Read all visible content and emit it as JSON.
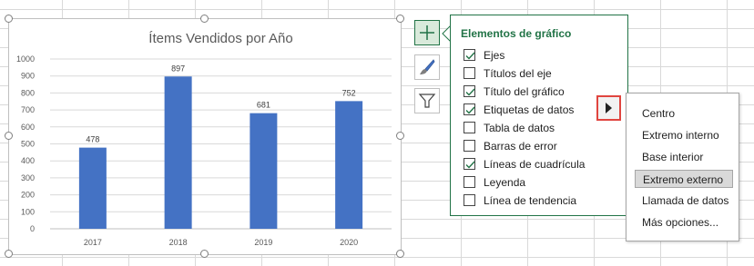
{
  "chart_data": {
    "type": "bar",
    "title": "Ítems Vendidos por Año",
    "categories": [
      "2017",
      "2018",
      "2019",
      "2020"
    ],
    "values": [
      478,
      897,
      681,
      752
    ],
    "ylim": [
      0,
      1000
    ],
    "yticks": [
      "0",
      "100",
      "200",
      "300",
      "400",
      "500",
      "600",
      "700",
      "800",
      "900",
      "1000"
    ],
    "bar_color": "#4472c4",
    "grid": true,
    "data_labels": [
      "478",
      "897",
      "681",
      "752"
    ]
  },
  "side_buttons": {
    "elements": "plus-icon",
    "styles": "brush-icon",
    "filters": "filter-icon"
  },
  "panel": {
    "title": "Elementos de gráfico",
    "options": [
      {
        "label": "Ejes",
        "checked": true
      },
      {
        "label": "Títulos del eje",
        "checked": false
      },
      {
        "label": "Título del gráfico",
        "checked": true
      },
      {
        "label": "Etiquetas de datos",
        "checked": true
      },
      {
        "label": "Tabla de datos",
        "checked": false
      },
      {
        "label": "Barras de error",
        "checked": false
      },
      {
        "label": "Líneas de cuadrícula",
        "checked": true
      },
      {
        "label": "Leyenda",
        "checked": false
      },
      {
        "label": "Línea de tendencia",
        "checked": false
      }
    ]
  },
  "submenu": {
    "items": [
      "Centro",
      "Extremo interno",
      "Base interior",
      "Extremo externo",
      "Llamada de datos",
      "Más opciones..."
    ],
    "selected": "Extremo externo"
  },
  "colors": {
    "accent": "#217346",
    "bar": "#4472c4",
    "highlight_border": "#e0453f"
  }
}
